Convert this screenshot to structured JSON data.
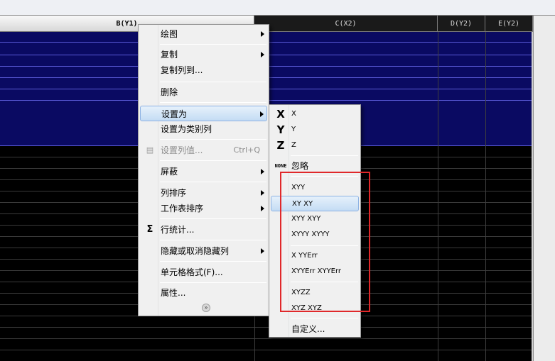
{
  "columns": [
    {
      "label": "B(Y1)",
      "selected": true
    },
    {
      "label": "C(X2)",
      "selected": false
    },
    {
      "label": "D(Y2)",
      "selected": false
    },
    {
      "label": "E(Y2)",
      "selected": false
    }
  ],
  "context_menu": {
    "items": [
      {
        "label": "绘图",
        "submenu": true
      },
      {
        "label": "复制",
        "submenu": true
      },
      {
        "label": "复制列到...",
        "submenu": false
      },
      {
        "label": "删除",
        "submenu": false
      },
      {
        "label": "设置为",
        "submenu": true,
        "highlighted": true
      },
      {
        "label": "设置为类别列",
        "submenu": false
      },
      {
        "label": "设置列值...",
        "shortcut": "Ctrl+Q",
        "disabled": true,
        "icon": "set-column-values-icon"
      },
      {
        "label": "屏蔽",
        "submenu": true
      },
      {
        "label": "列排序",
        "submenu": true
      },
      {
        "label": "工作表排序",
        "submenu": true
      },
      {
        "label": "行统计...",
        "icon": "row-statistics-icon"
      },
      {
        "label": "隐藏或取消隐藏列",
        "submenu": true
      },
      {
        "label": "单元格格式(F)..."
      },
      {
        "label": "属性..."
      }
    ],
    "more_icon": "double-chevron-down-icon"
  },
  "set_as_submenu": {
    "items": [
      {
        "label": "X",
        "icon_text": "X",
        "icon": "x-icon"
      },
      {
        "label": "Y",
        "icon_text": "Y",
        "icon": "y-icon"
      },
      {
        "label": "Z",
        "icon_text": "Z",
        "icon": "z-icon"
      },
      {
        "label": "忽略",
        "icon_text": "NONE",
        "icon": "none-icon"
      },
      {
        "label": "XYY"
      },
      {
        "label": "XY XY",
        "highlighted": true
      },
      {
        "label": "XYY XYY"
      },
      {
        "label": "XYYY XYYY"
      },
      {
        "label": "X YYErr"
      },
      {
        "label": "XYYErr XYYErr"
      },
      {
        "label": "XYZZ"
      },
      {
        "label": "XYZ XYZ"
      },
      {
        "label": "自定义..."
      }
    ]
  },
  "colors": {
    "selected_rows": "#0a0a62",
    "highlight": "#c4dcf4",
    "annotation_box": "#e0282a"
  }
}
